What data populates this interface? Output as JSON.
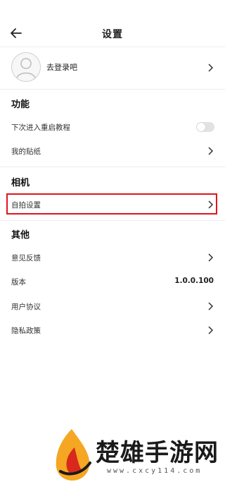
{
  "header": {
    "title": "设置",
    "back_icon": "arrow-left-icon"
  },
  "profile": {
    "label": "去登录吧",
    "avatar_icon": "user-avatar-icon"
  },
  "sections": {
    "features": {
      "title": "功能",
      "items": [
        {
          "label": "下次进入重启教程",
          "control": "toggle",
          "toggle_on": false
        },
        {
          "label": "我的贴纸",
          "control": "chevron"
        }
      ]
    },
    "camera": {
      "title": "相机",
      "items": [
        {
          "label": "自拍设置",
          "control": "chevron",
          "highlighted": true
        }
      ]
    },
    "other": {
      "title": "其他",
      "items": [
        {
          "label": "意见反馈",
          "control": "chevron"
        },
        {
          "label": "版本",
          "value": "1.0.0.100"
        },
        {
          "label": "用户协议",
          "control": "chevron"
        },
        {
          "label": "隐私政策",
          "control": "chevron"
        }
      ]
    }
  },
  "colors": {
    "highlight": "#e0141d",
    "toggle_off": "#e2e2e2",
    "watermark_orange": "#f5a623",
    "watermark_red": "#d9281c"
  },
  "watermark": {
    "text": "楚雄手游网",
    "url": "www.cxcy114.com"
  }
}
